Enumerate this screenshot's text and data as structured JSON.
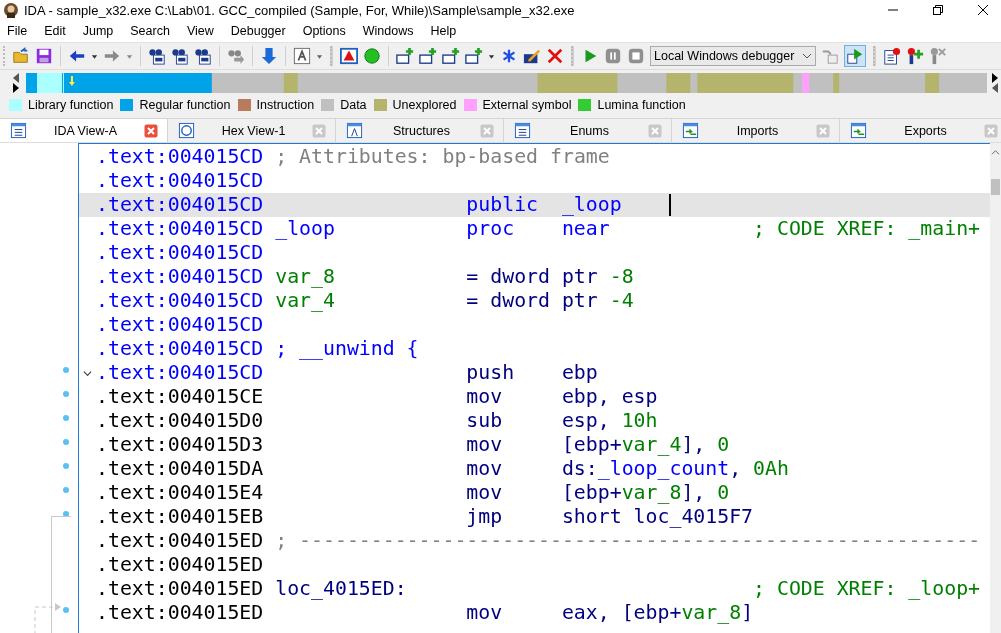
{
  "window": {
    "title": "IDA - sample_x32.exe C:\\Lab\\01. GCC_compiled (Sample, For, While)\\Sample\\sample_x32.exe"
  },
  "menu": [
    "File",
    "Edit",
    "Jump",
    "Search",
    "View",
    "Debugger",
    "Options",
    "Windows",
    "Help"
  ],
  "toolbar": {
    "debugger_select": {
      "value": "Local Windows debugger"
    },
    "toggle_button": {
      "pressed": true
    }
  },
  "legend": [
    {
      "label": "Library function",
      "color": "#aaffff"
    },
    {
      "label": "Regular function",
      "color": "#00a2e8"
    },
    {
      "label": "Instruction",
      "color": "#b87c5c"
    },
    {
      "label": "Data",
      "color": "#c0c0c0"
    },
    {
      "label": "Unexplored",
      "color": "#b4b46c"
    },
    {
      "label": "External symbol",
      "color": "#ffa0ff"
    },
    {
      "label": "Lumina function",
      "color": "#33cc33"
    }
  ],
  "tabs": [
    {
      "label": "IDA View-A",
      "kind": "disassembly",
      "selected": true
    },
    {
      "label": "Hex View-1",
      "kind": "hex",
      "selected": false
    },
    {
      "label": "Structures",
      "kind": "structures",
      "selected": false
    },
    {
      "label": "Enums",
      "kind": "enums",
      "selected": false
    },
    {
      "label": "Imports",
      "kind": "imports",
      "selected": false
    },
    {
      "label": "Exports",
      "kind": "exports",
      "selected": false
    }
  ],
  "lines": [
    {
      "kind": "function",
      "address": ".text:004015CD",
      "selected": false,
      "marker": false,
      "label": [
        {
          "text": "; Attributes: bp-based frame",
          "kind": "comment"
        }
      ]
    },
    {
      "kind": "function",
      "address": ".text:004015CD",
      "selected": false,
      "marker": false
    },
    {
      "kind": "function",
      "address": ".text:004015CD",
      "selected": true,
      "marker": false,
      "mnemonic": [
        {
          "text": "public",
          "kind": "name"
        }
      ],
      "operands": [
        {
          "text": "_loop",
          "kind": "name"
        }
      ]
    },
    {
      "kind": "function",
      "address": ".text:004015CD",
      "selected": false,
      "marker": false,
      "label": [
        {
          "text": "_loop",
          "kind": "name"
        }
      ],
      "mnemonic": [
        {
          "text": "proc",
          "kind": "name"
        }
      ],
      "operands": [
        {
          "text": "near",
          "kind": "name"
        }
      ],
      "comment": [
        {
          "text": "; CODE XREF: _main+",
          "kind": "xref"
        }
      ]
    },
    {
      "kind": "function",
      "address": ".text:004015CD",
      "selected": false,
      "marker": false
    },
    {
      "kind": "function",
      "address": ".text:004015CD",
      "selected": false,
      "marker": false,
      "label": [
        {
          "text": "var_8",
          "kind": "var"
        }
      ],
      "mnemonic": [
        {
          "text": "= dword ptr ",
          "kind": "plain"
        },
        {
          "text": "-8",
          "kind": "number"
        }
      ]
    },
    {
      "kind": "function",
      "address": ".text:004015CD",
      "selected": false,
      "marker": false,
      "label": [
        {
          "text": "var_4",
          "kind": "var"
        }
      ],
      "mnemonic": [
        {
          "text": "= dword ptr ",
          "kind": "plain"
        },
        {
          "text": "-4",
          "kind": "number"
        }
      ]
    },
    {
      "kind": "function",
      "address": ".text:004015CD",
      "selected": false,
      "marker": false
    },
    {
      "kind": "function",
      "address": ".text:004015CD",
      "selected": false,
      "marker": false,
      "label": [
        {
          "text": "; __unwind {",
          "kind": "name"
        }
      ]
    },
    {
      "kind": "function",
      "address": ".text:004015CD",
      "selected": false,
      "marker": true,
      "expanded": true,
      "mnemonic": [
        {
          "text": "push",
          "kind": "plain"
        }
      ],
      "operands": [
        {
          "text": "ebp",
          "kind": "plain"
        }
      ]
    },
    {
      "kind": "code",
      "address": ".text:004015CE",
      "selected": false,
      "marker": true,
      "mnemonic": [
        {
          "text": "mov",
          "kind": "plain"
        }
      ],
      "operands": [
        {
          "text": "ebp, esp",
          "kind": "plain"
        }
      ]
    },
    {
      "kind": "code",
      "address": ".text:004015D0",
      "selected": false,
      "marker": true,
      "mnemonic": [
        {
          "text": "sub",
          "kind": "plain"
        }
      ],
      "operands": [
        {
          "text": "esp, ",
          "kind": "plain"
        },
        {
          "text": "10h",
          "kind": "number"
        }
      ]
    },
    {
      "kind": "code",
      "address": ".text:004015D3",
      "selected": false,
      "marker": true,
      "mnemonic": [
        {
          "text": "mov",
          "kind": "plain"
        }
      ],
      "operands": [
        {
          "text": "[ebp+",
          "kind": "plain"
        },
        {
          "text": "var_4",
          "kind": "var"
        },
        {
          "text": "], ",
          "kind": "plain"
        },
        {
          "text": "0",
          "kind": "number"
        }
      ]
    },
    {
      "kind": "code",
      "address": ".text:004015DA",
      "selected": false,
      "marker": true,
      "mnemonic": [
        {
          "text": "mov",
          "kind": "plain"
        }
      ],
      "operands": [
        {
          "text": "ds:",
          "kind": "plain"
        },
        {
          "text": "_loop_count",
          "kind": "name"
        },
        {
          "text": ", ",
          "kind": "plain"
        },
        {
          "text": "0Ah",
          "kind": "number"
        }
      ]
    },
    {
      "kind": "code",
      "address": ".text:004015E4",
      "selected": false,
      "marker": true,
      "mnemonic": [
        {
          "text": "mov",
          "kind": "plain"
        }
      ],
      "operands": [
        {
          "text": "[ebp+",
          "kind": "plain"
        },
        {
          "text": "var_8",
          "kind": "var"
        },
        {
          "text": "], ",
          "kind": "plain"
        },
        {
          "text": "0",
          "kind": "number"
        }
      ]
    },
    {
      "kind": "code",
      "address": ".text:004015EB",
      "selected": false,
      "marker": true,
      "mnemonic": [
        {
          "text": "jmp",
          "kind": "plain"
        }
      ],
      "operands": [
        {
          "text": "short loc_4015F7",
          "kind": "plain"
        }
      ]
    },
    {
      "kind": "code",
      "address": ".text:004015ED",
      "selected": false,
      "marker": false,
      "label": [
        {
          "text": "; ---------------------------------------------------------",
          "kind": "comment"
        }
      ]
    },
    {
      "kind": "code",
      "address": ".text:004015ED",
      "selected": false,
      "marker": false
    },
    {
      "kind": "code",
      "address": ".text:004015ED",
      "selected": false,
      "marker": false,
      "label": [
        {
          "text": "loc_4015ED:",
          "kind": "plain"
        }
      ],
      "comment": [
        {
          "text": "; CODE XREF: _loop+",
          "kind": "xref"
        }
      ]
    },
    {
      "kind": "code",
      "address": ".text:004015ED",
      "selected": false,
      "marker": true,
      "mnemonic": [
        {
          "text": "mov",
          "kind": "plain"
        }
      ],
      "operands": [
        {
          "text": "eax, [ebp+",
          "kind": "plain"
        },
        {
          "text": "var_8",
          "kind": "var"
        },
        {
          "text": "]",
          "kind": "plain"
        }
      ]
    }
  ]
}
